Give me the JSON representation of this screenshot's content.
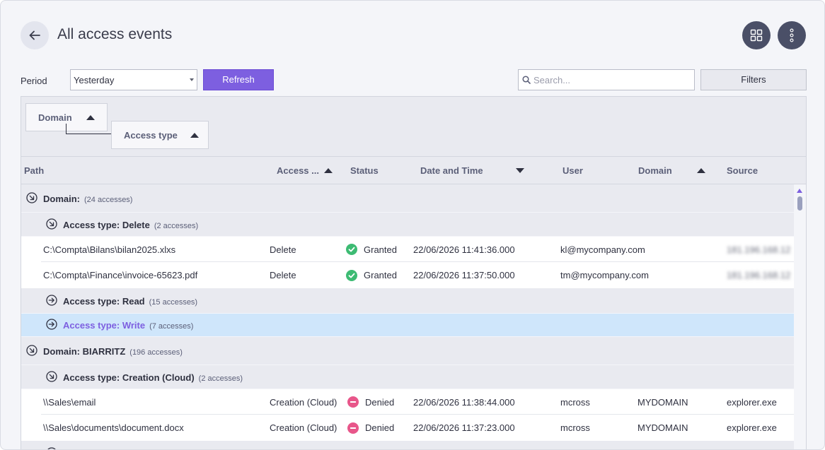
{
  "header": {
    "title": "All access events",
    "back_icon": "arrow-left-icon",
    "grid_icon": "grid-icon",
    "more_icon": "more-vertical-icon"
  },
  "toolbar": {
    "period_label": "Period",
    "period_value": "Yesterday",
    "refresh_label": "Refresh",
    "search_placeholder": "Search...",
    "filters_label": "Filters"
  },
  "group_panel": {
    "chips": [
      "Domain",
      "Access type"
    ]
  },
  "columns": {
    "path": "Path",
    "access": "Access ...",
    "status": "Status",
    "datetime": "Date and Time",
    "user": "User",
    "domain": "Domain",
    "source": "Source"
  },
  "groups": [
    {
      "label": "Domain:",
      "count": "(24 accesses)",
      "subgroups": [
        {
          "label": "Access type: Delete",
          "count": "(2 accesses)",
          "rows": [
            {
              "path": "C:\\Compta\\Bilans\\bilan2025.xlxs",
              "access": "Delete",
              "status": "Granted",
              "datetime": "22/06/2026 11:41:36.000",
              "user": "kl@mycompany.com",
              "domain": "",
              "source": "181.196.168.12"
            },
            {
              "path": "C:\\Compta\\Finance\\invoice-65623.pdf",
              "access": "Delete",
              "status": "Granted",
              "datetime": "22/06/2026 11:37:50.000",
              "user": "tm@mycompany.com",
              "domain": "",
              "source": "181.196.168.12"
            }
          ]
        },
        {
          "label": "Access type: Read",
          "count": "(15 accesses)"
        },
        {
          "label": "Access type: Write",
          "count": "(7 accesses)"
        }
      ]
    },
    {
      "label": "Domain: BIARRITZ",
      "count": "(196 accesses)",
      "subgroups": [
        {
          "label": "Access type: Creation (Cloud)",
          "count": "(2 accesses)",
          "rows": [
            {
              "path": "\\\\Sales\\email",
              "access": "Creation (Cloud)",
              "status": "Denied",
              "datetime": "22/06/2026 11:38:44.000",
              "user": "mcross",
              "domain": "MYDOMAIN",
              "source": "explorer.exe"
            },
            {
              "path": "\\\\Sales\\documents\\document.docx",
              "access": "Creation (Cloud)",
              "status": "Denied",
              "datetime": "22/06/2026 11:37:23.000",
              "user": "mcross",
              "domain": "MYDOMAIN",
              "source": "explorer.exe"
            }
          ]
        }
      ]
    }
  ],
  "colors": {
    "accent": "#7d5fe0",
    "granted": "#3dbb73",
    "denied": "#e8568a",
    "selected_row": "#cfe6fb"
  }
}
